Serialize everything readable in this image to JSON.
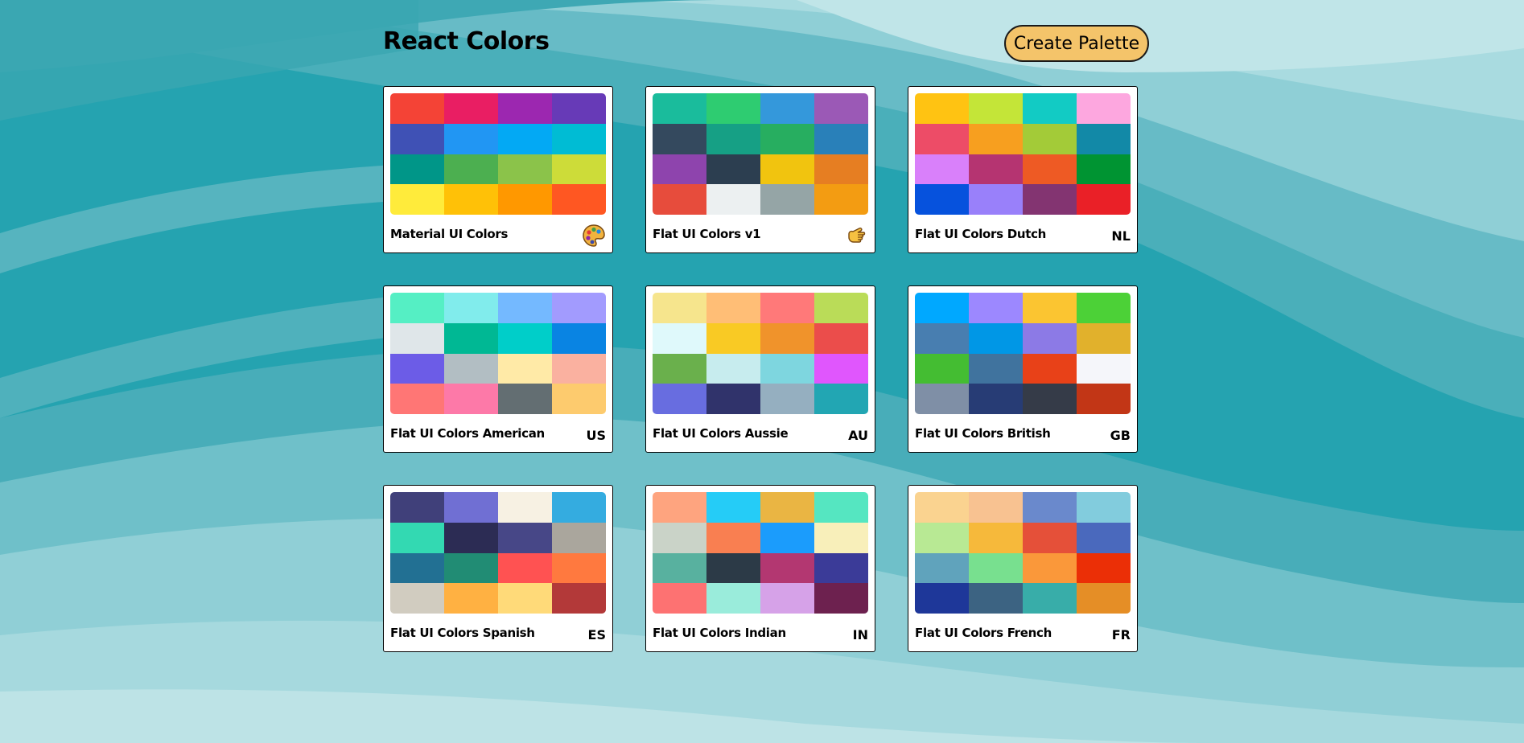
{
  "header": {
    "title": "React Colors",
    "create_label": "Create Palette"
  },
  "palettes": [
    {
      "name": "Material UI Colors",
      "emoji": "palette-icon",
      "colors": [
        "#f44336",
        "#e91e63",
        "#9c27b0",
        "#673ab7",
        "#3f51b5",
        "#2196f3",
        "#03a9f4",
        "#00bcd4",
        "#009688",
        "#4caf50",
        "#8bc34a",
        "#cddc39",
        "#ffeb3b",
        "#ffc107",
        "#ff9800",
        "#ff5722"
      ]
    },
    {
      "name": "Flat UI Colors v1",
      "emoji": "hand-icon",
      "colors": [
        "#1abc9c",
        "#2ecc71",
        "#3498db",
        "#9b59b6",
        "#34495e",
        "#16a085",
        "#27ae60",
        "#2980b9",
        "#8e44ad",
        "#2c3e50",
        "#f1c40f",
        "#e67e22",
        "#e74c3c",
        "#ecf0f1",
        "#95a5a6",
        "#f39c12"
      ]
    },
    {
      "name": "Flat UI Colors Dutch",
      "emoji": "NL",
      "colors": [
        "#ffc312",
        "#c4e538",
        "#12cbc4",
        "#fda7df",
        "#ed4c67",
        "#f79f1f",
        "#a3cb38",
        "#1289a7",
        "#d980fa",
        "#b53471",
        "#ee5a24",
        "#009432",
        "#0652dd",
        "#9980fa",
        "#833471",
        "#ea2027"
      ]
    },
    {
      "name": "Flat UI Colors American",
      "emoji": "US",
      "colors": [
        "#55efc4",
        "#81ecec",
        "#74b9ff",
        "#a29bfe",
        "#dfe6e9",
        "#00b894",
        "#00cec9",
        "#0984e3",
        "#6c5ce7",
        "#b2bec3",
        "#ffeaa7",
        "#fab1a0",
        "#ff7675",
        "#fd79a8",
        "#636e72",
        "#fdcb6e"
      ]
    },
    {
      "name": "Flat UI Colors Aussie",
      "emoji": "AU",
      "colors": [
        "#f6e58d",
        "#ffbe76",
        "#ff7979",
        "#badc58",
        "#dff9fb",
        "#f9ca24",
        "#f0932b",
        "#eb4d4b",
        "#6ab04c",
        "#c7ecee",
        "#7ed6df",
        "#e056fd",
        "#686de0",
        "#30336b",
        "#95afc0",
        "#22a6b3"
      ]
    },
    {
      "name": "Flat UI Colors British",
      "emoji": "GB",
      "colors": [
        "#00a8ff",
        "#9c88ff",
        "#fbc531",
        "#4cd137",
        "#487eb0",
        "#0097e6",
        "#8c7ae6",
        "#e1b12c",
        "#44bd32",
        "#40739e",
        "#e84118",
        "#f5f6fa",
        "#7f8fa6",
        "#273c75",
        "#353b48",
        "#c23616"
      ]
    },
    {
      "name": "Flat UI Colors Spanish",
      "emoji": "ES",
      "colors": [
        "#40407a",
        "#706fd3",
        "#f7f1e3",
        "#34ace0",
        "#33d9b2",
        "#2c2c54",
        "#474787",
        "#aaa69d",
        "#227093",
        "#218c74",
        "#ff5252",
        "#ff793f",
        "#d1ccc0",
        "#ffb142",
        "#ffda79",
        "#b33939"
      ]
    },
    {
      "name": "Flat UI Colors Indian",
      "emoji": "IN",
      "colors": [
        "#fea47f",
        "#25ccf7",
        "#eab543",
        "#55e6c1",
        "#cad3c8",
        "#f97f51",
        "#1b9cfc",
        "#f8efba",
        "#58b19f",
        "#2c3a47",
        "#b33771",
        "#3b3b98",
        "#fd7272",
        "#9aecdb",
        "#d6a2e8",
        "#6d214f"
      ]
    },
    {
      "name": "Flat UI Colors French",
      "emoji": "FR",
      "colors": [
        "#fad390",
        "#f8c291",
        "#6a89cc",
        "#82ccdd",
        "#b8e994",
        "#f6b93b",
        "#e55039",
        "#4a69bd",
        "#60a3bc",
        "#78e08f",
        "#fa983a",
        "#eb2f06",
        "#1e3799",
        "#3c6382",
        "#38ada9",
        "#e58e26"
      ]
    }
  ]
}
